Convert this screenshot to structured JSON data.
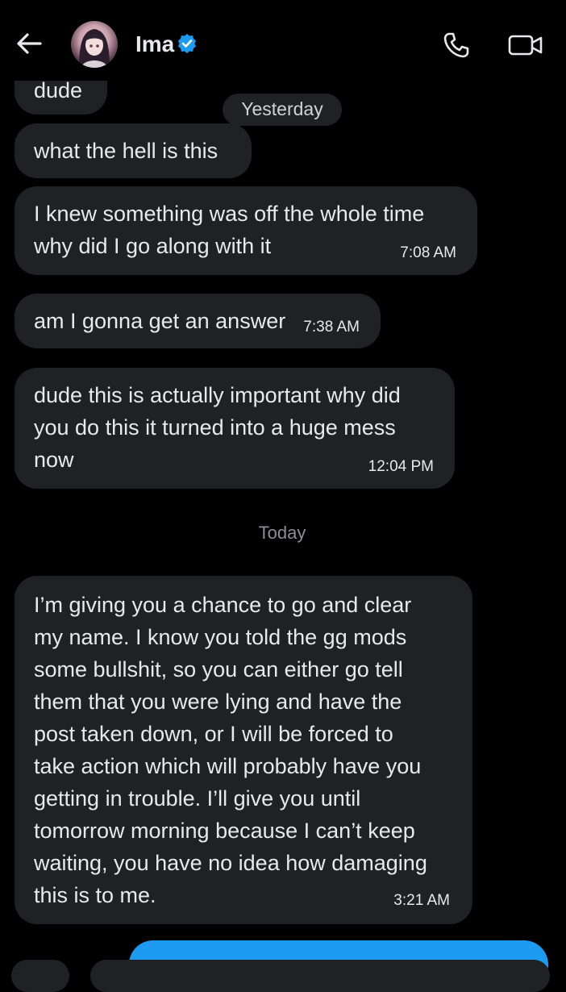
{
  "header": {
    "contact_name": "Ima",
    "back_icon": "arrow-left-icon",
    "verified_icon": "verified-badge-icon",
    "call_icon": "phone-icon",
    "video_icon": "video-camera-icon",
    "accent_color": "#1d9bf0"
  },
  "messages": [
    {
      "text": "dude",
      "time": ""
    },
    {
      "text": "what the hell is this",
      "time": ""
    },
    {
      "text": "I knew something was off the whole time\nwhy did I go along with it",
      "time": "7:08 AM"
    },
    {
      "text": "am I gonna get an answer",
      "time": "7:38 AM"
    },
    {
      "text": "dude this is actually important why did\nyou do this it turned into a huge mess\nnow",
      "time": "12:04 PM"
    },
    {
      "text": "I’m giving you a chance to go and clear\nmy name. I know you told the gg mods\nsome bullshit, so you can either go tell\nthem that you were lying and have the\npost taken down, or I will be forced to\ntake action which will probably have you\ngetting in trouble. I’ll give you until\ntomorrow morning because I can’t keep\nwaiting, you have no idea how damaging\nthis is to me.",
      "time": "3:21 AM"
    }
  ],
  "dates": {
    "yesterday": "Yesterday",
    "today": "Today"
  }
}
